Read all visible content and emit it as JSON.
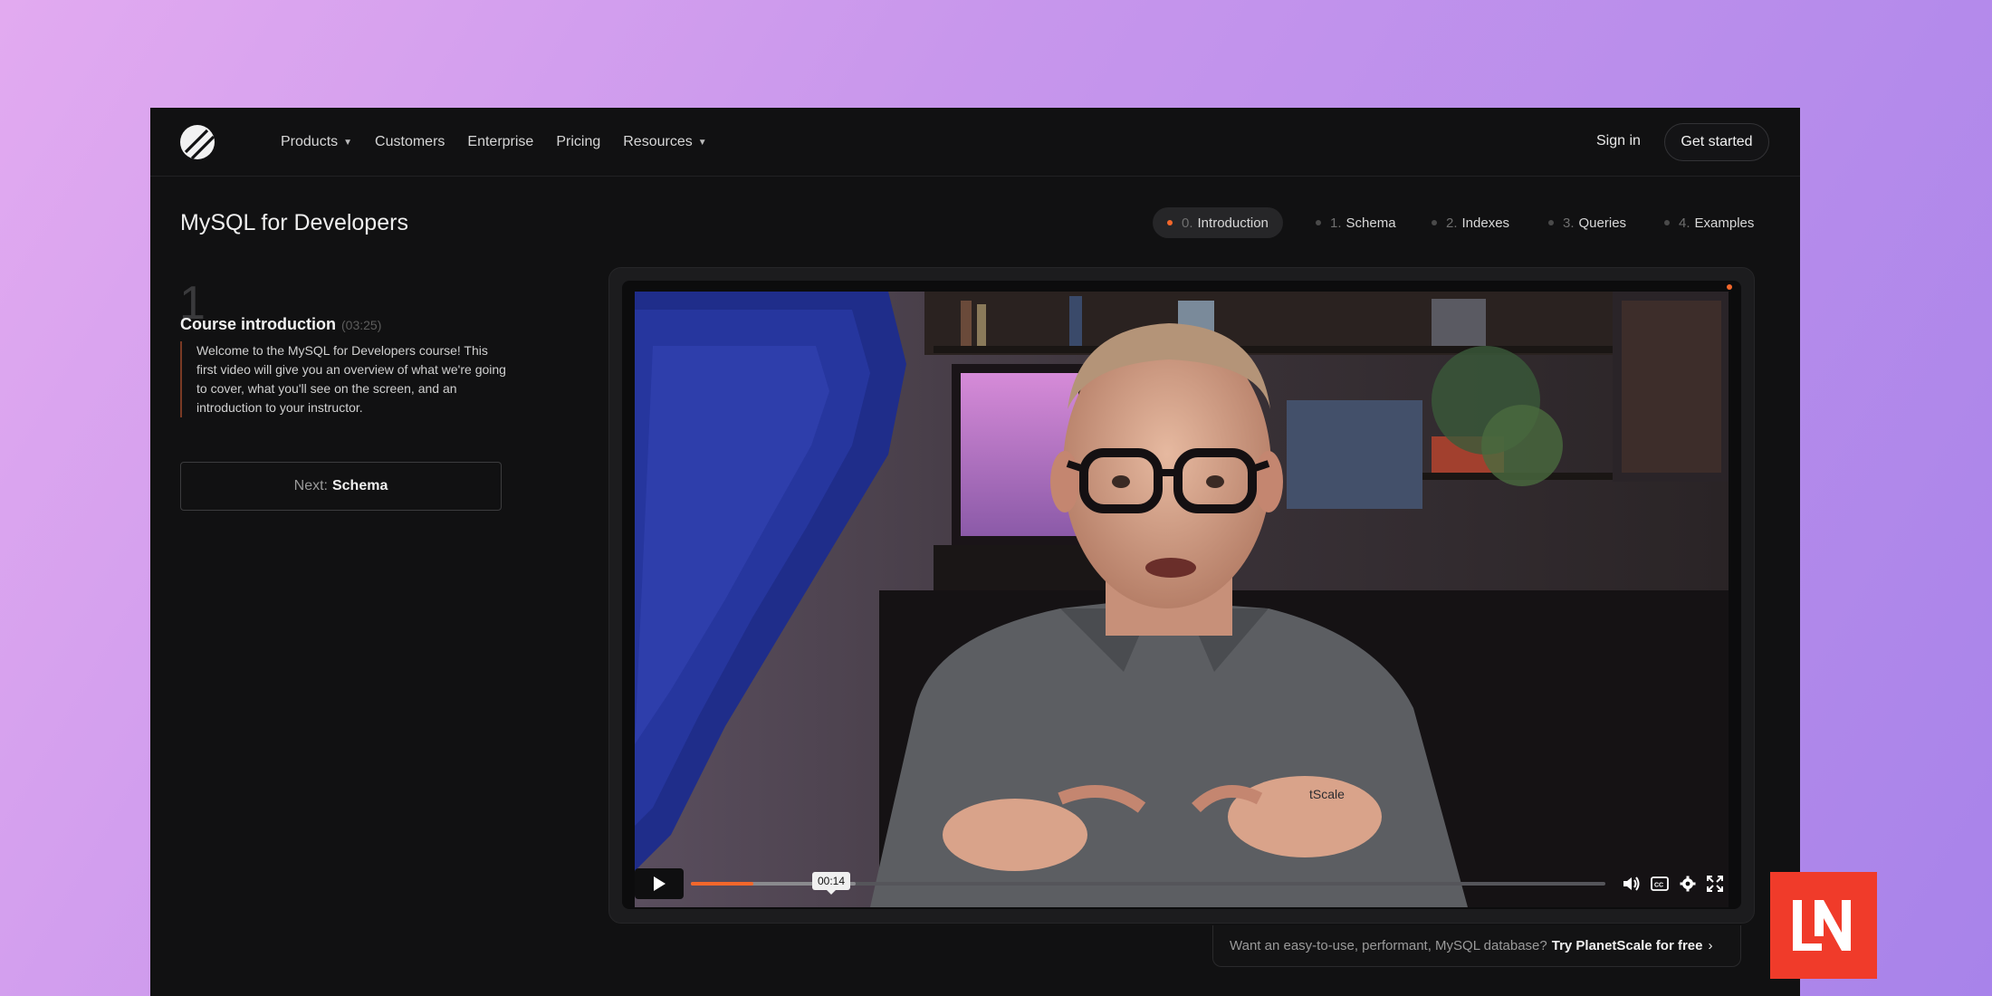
{
  "nav": {
    "items": [
      {
        "label": "Products",
        "dropdown": true
      },
      {
        "label": "Customers",
        "dropdown": false
      },
      {
        "label": "Enterprise",
        "dropdown": false
      },
      {
        "label": "Pricing",
        "dropdown": false
      },
      {
        "label": "Resources",
        "dropdown": true
      }
    ],
    "sign_in": "Sign in",
    "get_started": "Get started"
  },
  "page": {
    "title": "MySQL for Developers",
    "tabs": [
      {
        "num": "0.",
        "label": "Introduction",
        "active": true
      },
      {
        "num": "1.",
        "label": "Schema",
        "active": false
      },
      {
        "num": "2.",
        "label": "Indexes",
        "active": false
      },
      {
        "num": "3.",
        "label": "Queries",
        "active": false
      },
      {
        "num": "4.",
        "label": "Examples",
        "active": false
      }
    ]
  },
  "lesson": {
    "number": "1",
    "title": "Course introduction",
    "duration": "(03:25)",
    "description": "Welcome to the MySQL for Developers course! This first video will give you an overview of what we're going to cover, what you'll see on the screen, and an introduction to your instructor.",
    "next_prefix": "Next:",
    "next_label": "Schema"
  },
  "player": {
    "hover_time": "00:14",
    "progress": 0.068,
    "buffered": 0.18
  },
  "promo": {
    "text": "Want an easy-to-use, performant, MySQL database?",
    "link": "Try PlanetScale for free",
    "arrow": "›"
  },
  "colors": {
    "accent": "#f3672b",
    "badge": "#f03b2a",
    "background": "#111112"
  },
  "icons": {
    "logo": "planetscale-logo-icon",
    "play": "play-icon",
    "volume": "volume-icon",
    "captions": "captions-icon",
    "settings": "gear-icon",
    "fullscreen": "fullscreen-icon",
    "pip": "picture-in-picture-icon",
    "badge": "laravel-news-logo-icon"
  }
}
